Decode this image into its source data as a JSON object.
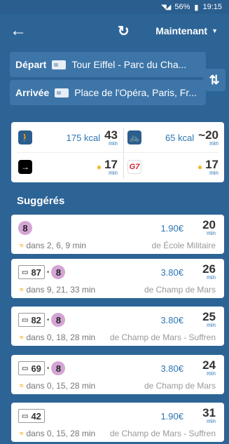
{
  "status": {
    "battery": "56%",
    "time": "19:15"
  },
  "header": {
    "time_selector": "Maintenant"
  },
  "departure": {
    "label": "Départ",
    "value": "Tour Eiffel - Parc du Cha..."
  },
  "arrival": {
    "label": "Arrivée",
    "value": "Place de l'Opéra, Paris, Fr..."
  },
  "modes": {
    "walk": {
      "kcal": "175 kcal",
      "minutes": "43",
      "unit": "min"
    },
    "bike": {
      "kcal": "65 kcal",
      "minutes": "~20",
      "unit": "min"
    },
    "uber": {
      "minutes": "17",
      "unit": "min"
    },
    "g7": {
      "logo": "G7",
      "minutes": "17",
      "unit": "min"
    }
  },
  "suggested_title": "Suggérés",
  "routes": [
    {
      "lines": [
        "8"
      ],
      "price": "1.90€",
      "duration": "20",
      "unit": "min",
      "departures": "dans 2, 6, 9 min",
      "from": "de École Militaire"
    },
    {
      "bus": "87",
      "metro": "8",
      "price": "3.80€",
      "duration": "26",
      "unit": "min",
      "departures": "dans 9, 21, 33 min",
      "from": "de Champ de Mars"
    },
    {
      "bus": "82",
      "metro": "8",
      "price": "3.80€",
      "duration": "25",
      "unit": "min",
      "departures": "dans 0, 18, 28 min",
      "from": "de Champ de Mars - Suffren"
    },
    {
      "bus": "69",
      "metro": "8",
      "price": "3.80€",
      "duration": "24",
      "unit": "min",
      "departures": "dans 0, 15, 28 min",
      "from": "de Champ de Mars"
    },
    {
      "bus": "42",
      "price": "1.90€",
      "duration": "31",
      "unit": "min",
      "departures": "dans 0, 15, 28 min",
      "from": "de Champ de Mars - Suffren"
    }
  ],
  "colors": {
    "background": "#2d6496",
    "accent": "#2d76b5",
    "metro8": "#d4a5d4",
    "live": "#f0b92c"
  }
}
